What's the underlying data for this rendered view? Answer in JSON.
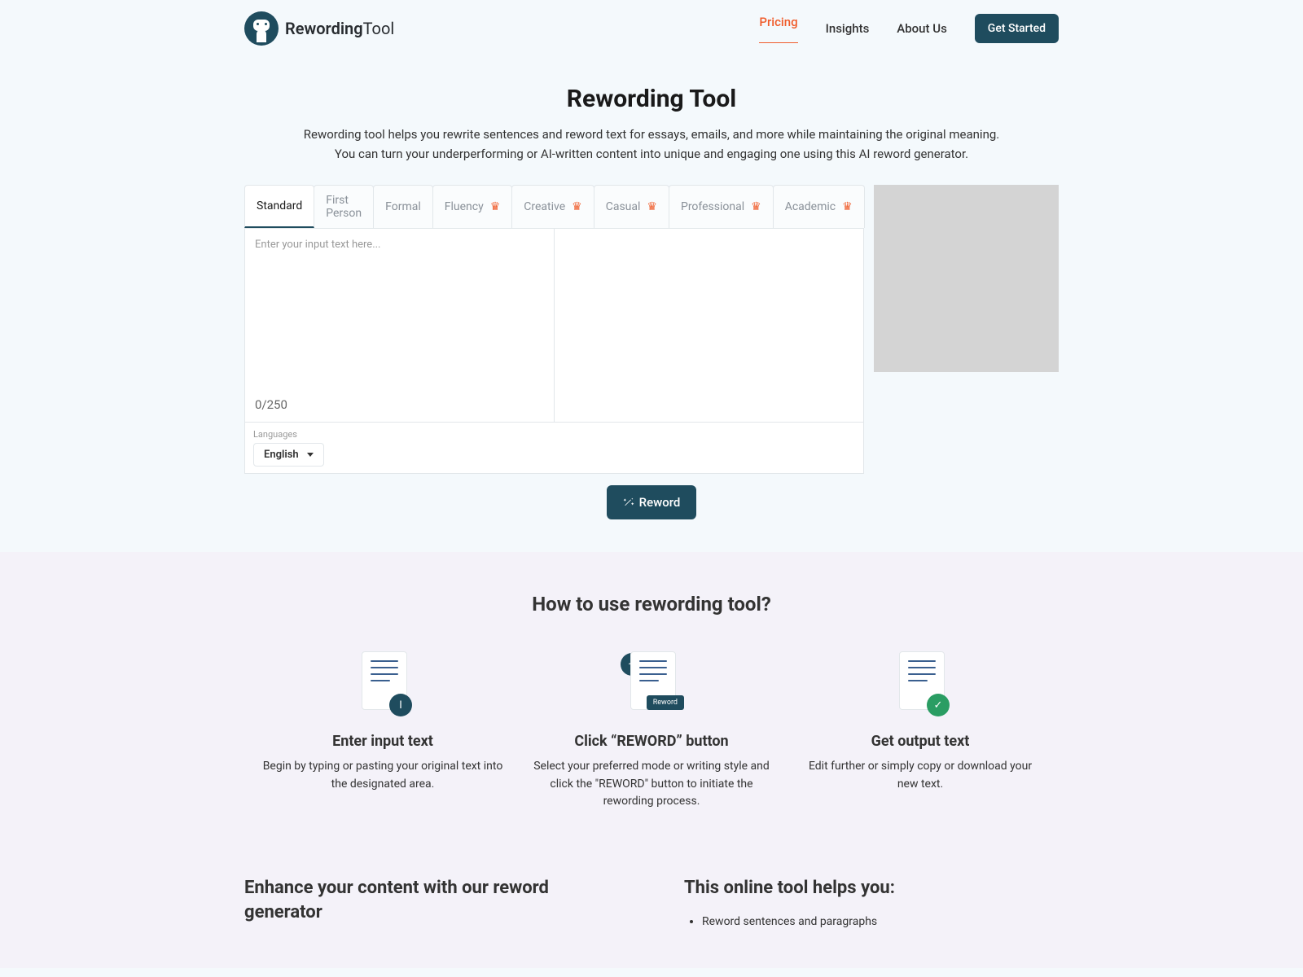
{
  "brand": {
    "name_a": "Rewording",
    "name_b": "Tool"
  },
  "nav": {
    "pricing": "Pricing",
    "insights": "Insights",
    "about": "About Us",
    "cta": "Get Started"
  },
  "hero": {
    "title": "Rewording Tool",
    "subtitle": "Rewording tool helps you rewrite sentences and reword text for essays, emails, and more while maintaining the original meaning. You can turn your underperforming or AI-written content into unique and engaging one using this AI reword generator."
  },
  "tabs": [
    "Standard",
    "First Person",
    "Formal",
    "Fluency",
    "Creative",
    "Casual",
    "Professional",
    "Academic"
  ],
  "editor": {
    "placeholder": "Enter your input text here...",
    "counter": "0/250"
  },
  "toolbar": {
    "label": "Languages",
    "value": "English"
  },
  "action": {
    "reword": "Reword"
  },
  "howto": {
    "title": "How to use rewording tool?",
    "steps": [
      {
        "title": "Enter input text",
        "desc": "Begin by typing or pasting your original text into the designated area."
      },
      {
        "title": "Click “REWORD” button",
        "desc": "Select your preferred mode or writing style and click the \"REWORD\" button to initiate the rewording process.",
        "mini": "Reword"
      },
      {
        "title": "Get output text",
        "desc": "Edit further or simply copy or download your new text."
      }
    ]
  },
  "bottom": {
    "left_title": "Enhance your content with our reword generator",
    "right_title": "This online tool helps you:",
    "bullets": [
      "Reword sentences and paragraphs"
    ]
  }
}
